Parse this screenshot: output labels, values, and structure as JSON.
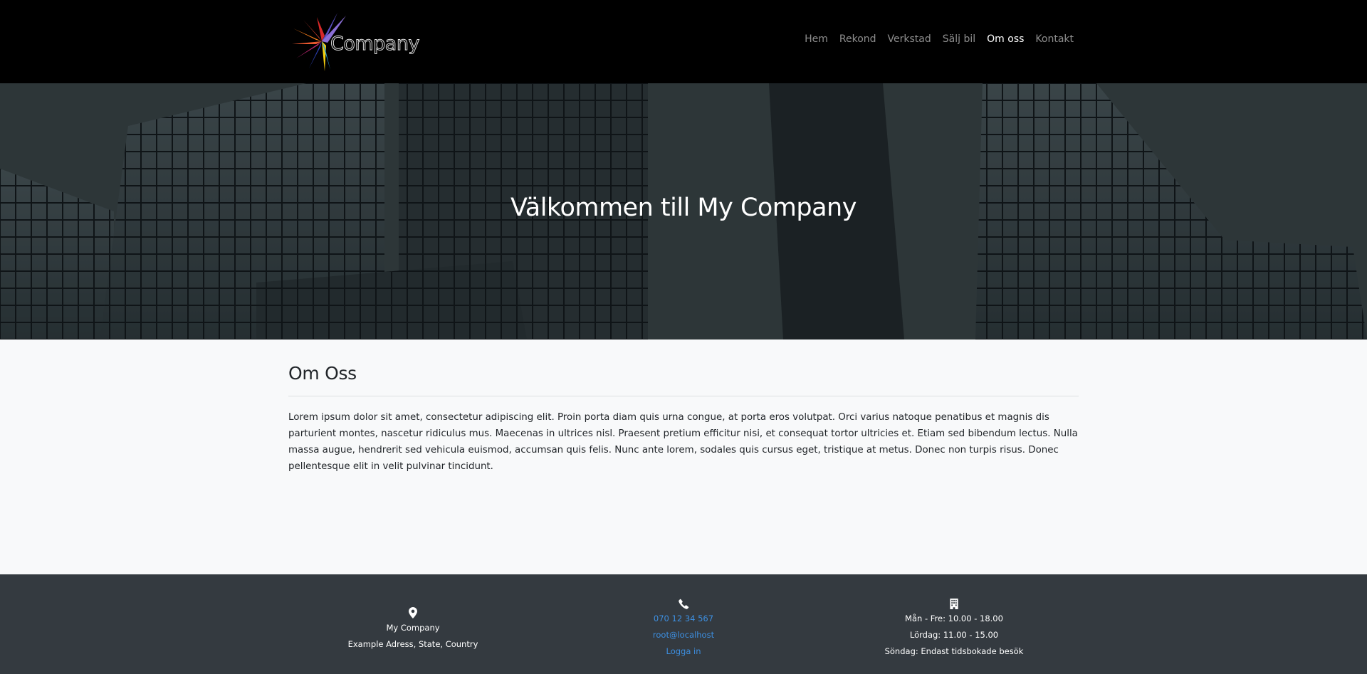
{
  "navbar": {
    "brand_text": "Company",
    "links": [
      {
        "label": "Hem"
      },
      {
        "label": "Rekond"
      },
      {
        "label": "Verkstad"
      },
      {
        "label": "Sälj bil"
      },
      {
        "label": "Om oss",
        "active": true
      },
      {
        "label": "Kontakt"
      }
    ]
  },
  "hero": {
    "title": "Välkommen till My Company"
  },
  "main": {
    "heading": "Om Oss",
    "body": "Lorem ipsum dolor sit amet, consectetur adipiscing elit. Proin porta diam quis urna congue, at porta eros volutpat. Orci varius natoque penatibus et magnis dis parturient montes, nascetur ridiculus mus. Maecenas in ultrices nisl. Praesent pretium efficitur nisi, et consequat tortor ultricies et. Etiam sed bibendum lectus. Nulla massa augue, hendrerit sed vehicula euismod, accumsan quis felis. Nunc ante lorem, sodales quis cursus eget, tristique at metus. Donec non turpis risus. Donec pellentesque elit in velit pulvinar tincidunt."
  },
  "footer": {
    "address": {
      "icon": "map-pin-icon",
      "name": "My Company",
      "line": "Example Adress, State, Country"
    },
    "contact": {
      "icon": "phone-icon",
      "phone": "070 12 34 567",
      "email": "root@localhost",
      "login": "Logga in"
    },
    "hours": {
      "icon": "building-icon",
      "weekdays": "Mån - Fre: 10.00 - 18.00",
      "saturday": "Lördag: 11.00 - 15.00",
      "sunday": "Söndag: Endast tidsbokade besök"
    }
  },
  "colors": {
    "navbar": "#000000",
    "footer": "#343a40",
    "link": "#3d8fe0",
    "page": "#f8f9fa"
  }
}
